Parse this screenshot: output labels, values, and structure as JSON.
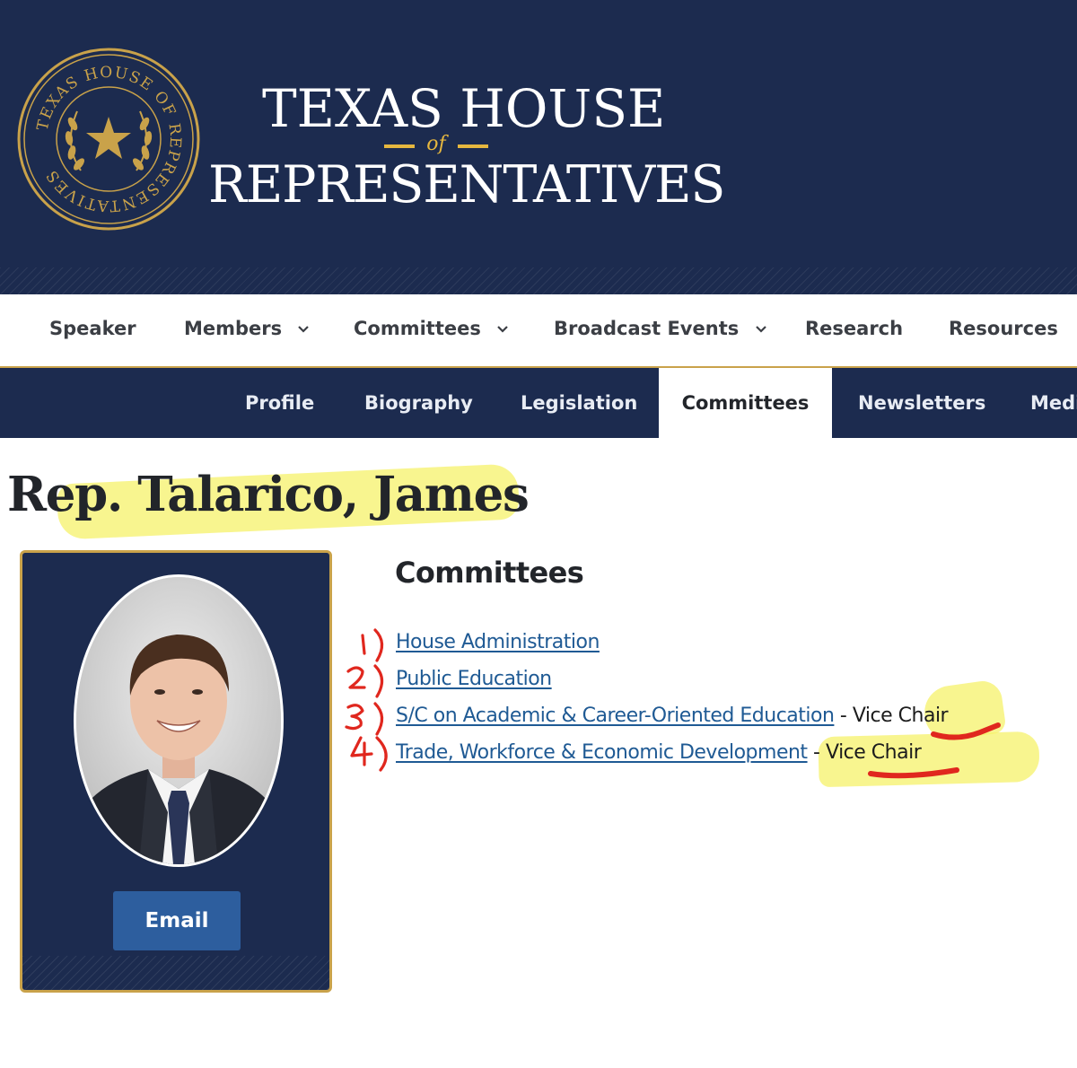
{
  "header": {
    "title_line1": "TEXAS HOUSE",
    "title_of": "of",
    "title_line2": "REPRESENTATIVES",
    "seal_text": "TEXAS HOUSE OF REPRESENTATIVES",
    "colors": {
      "navy": "#1c2b4f",
      "gold": "#c9a24a"
    }
  },
  "primary_nav": {
    "items": [
      {
        "label": "Speaker",
        "dropdown": false
      },
      {
        "label": "Members",
        "dropdown": true
      },
      {
        "label": "Committees",
        "dropdown": true
      },
      {
        "label": "Broadcast Events",
        "dropdown": true
      },
      {
        "label": "Research",
        "dropdown": false
      },
      {
        "label": "Resources",
        "dropdown": false
      }
    ]
  },
  "secondary_nav": {
    "items": [
      {
        "label": "Profile"
      },
      {
        "label": "Biography"
      },
      {
        "label": "Legislation"
      },
      {
        "label": "Committees",
        "active": true
      },
      {
        "label": "Newsletters"
      },
      {
        "label": "Medi"
      }
    ]
  },
  "member": {
    "name": "Rep. Talarico, James",
    "email_button": "Email",
    "photo_icon": "member-portrait"
  },
  "committees": {
    "heading": "Committees",
    "items": [
      {
        "name": "House Administration",
        "role": ""
      },
      {
        "name": "Public Education",
        "role": ""
      },
      {
        "name": "S/C on Academic & Career-Oriented Education",
        "role": "Vice Chair"
      },
      {
        "name": "Trade, Workforce & Economic Development",
        "role": "Vice Chair"
      }
    ],
    "role_separator": " - "
  },
  "annotations": {
    "markers": [
      "1)",
      "2)",
      "3)",
      "4)"
    ],
    "highlight_color": "#f6f26a",
    "ink_color": "#e0271e"
  }
}
